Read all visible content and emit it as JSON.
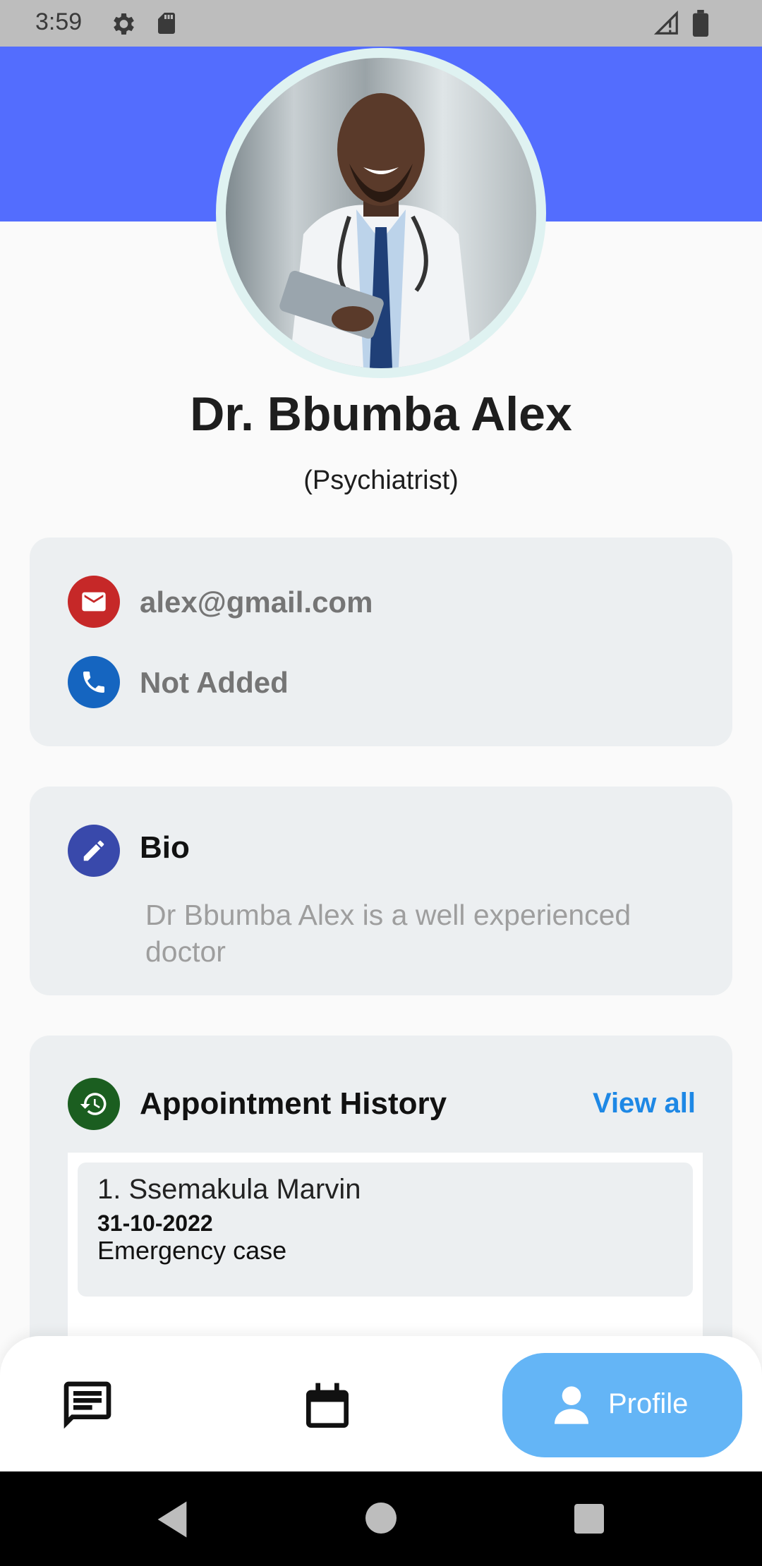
{
  "status_bar": {
    "time": "3:59"
  },
  "doctor": {
    "name": "Dr. Bbumba Alex",
    "role": "(Psychiatrist)"
  },
  "contact": {
    "email": "alex@gmail.com",
    "phone": "Not Added"
  },
  "bio": {
    "title": "Bio",
    "text": "Dr Bbumba Alex is a well experienced doctor"
  },
  "appointments": {
    "title": "Appointment History",
    "view_all": "View all",
    "items": [
      {
        "name": "1. Ssemakula Marvin",
        "date": "31-10-2022",
        "type": "Emergency case"
      }
    ]
  },
  "bottom_nav": {
    "profile_label": "Profile"
  },
  "colors": {
    "header": "#536dfe",
    "email_icon": "#c62828",
    "phone_icon": "#1565c0",
    "bio_icon": "#3949ab",
    "history_icon": "#1b5e20",
    "accent": "#1e88e5",
    "profile_pill": "#64b5f6"
  },
  "icons": {
    "status": [
      "gear-icon",
      "sd-card-icon",
      "signal-icon",
      "battery-icon"
    ],
    "contact": [
      "email-icon",
      "phone-icon"
    ],
    "bio": "pencil-icon",
    "history": "history-icon",
    "nav": [
      "chat-icon",
      "calendar-icon",
      "person-icon"
    ],
    "system": [
      "back-icon",
      "home-icon",
      "recents-icon"
    ]
  }
}
